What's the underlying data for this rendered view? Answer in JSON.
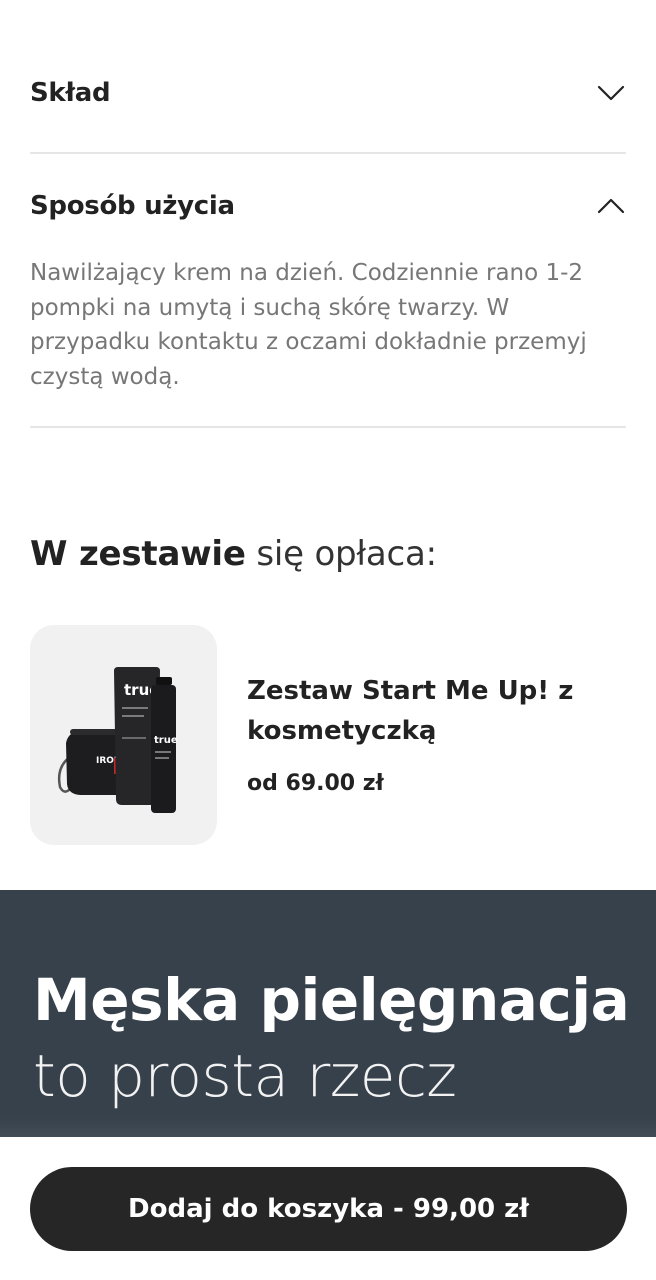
{
  "accordion": {
    "sklad": {
      "title": "Skład",
      "icon": "chevron-down-icon"
    },
    "sposob": {
      "title": "Sposób użycia",
      "icon": "chevron-up-icon",
      "content": "Nawilżający krem na dzień. Codziennie rano 1-2 pompki na umytą i suchą skórę twarzy. W przypadku kontaktu z oczami dokładnie przemyj czystą wodą."
    }
  },
  "bundle": {
    "heading_bold": "W zestawie",
    "heading_rest": " się opłaca:",
    "product": {
      "name": "Zestaw Start Me Up! z kosmetyczką",
      "price": "od 69.00 zł",
      "image_brand": "true",
      "bag_label": "IRONMAN"
    }
  },
  "promo": {
    "bold": "Męska pielęgnacja",
    "rest": " to prosta rzecz"
  },
  "cart": {
    "label": "Dodaj do koszyka - 99,00 zł"
  },
  "colors": {
    "promo_bg": "#36414b",
    "button_bg": "#262626",
    "text_muted": "#777777",
    "divider": "#e6e6e6"
  }
}
